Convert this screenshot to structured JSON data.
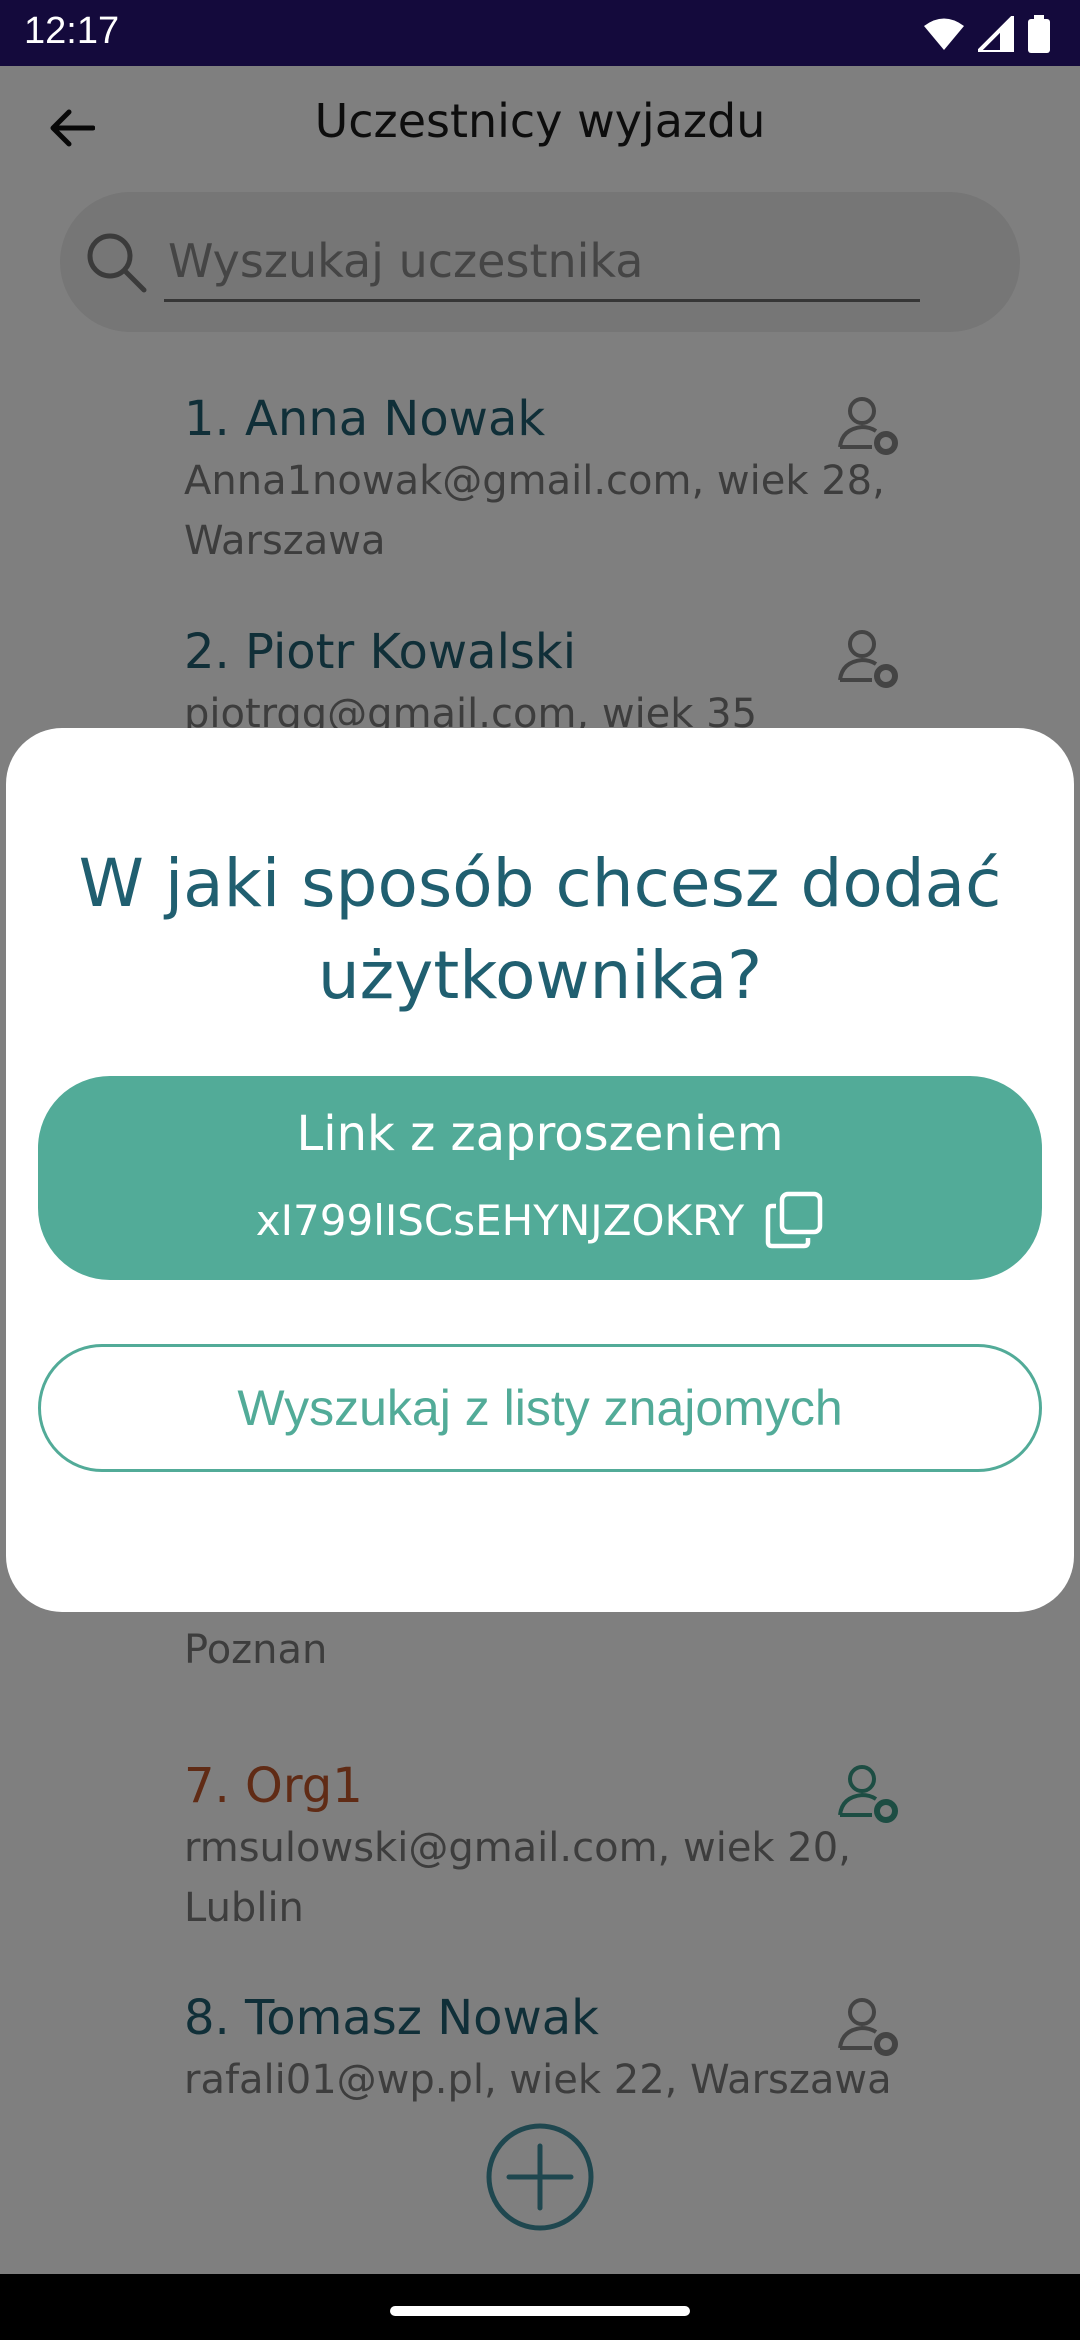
{
  "status_bar": {
    "time": "12:17"
  },
  "screen": {
    "title": "Uczestnicy wyjazdu",
    "search_placeholder": "Wyszukaj uczestnika"
  },
  "participants": [
    {
      "name": "1. Anna Nowak",
      "details": "Anna1nowak@gmail.com, wiek 28, Warszawa"
    },
    {
      "name": "2. Piotr Kowalski",
      "details": "piotrgg@gmail.com, wiek 35"
    },
    {
      "name": "",
      "details": "Poznan"
    },
    {
      "name": "7. Org1",
      "details": "rmsulowski@gmail.com, wiek 20, Lublin"
    },
    {
      "name": "8. Tomasz Nowak",
      "details": "rafali01@wp.pl, wiek 22, Warszawa"
    }
  ],
  "dialog": {
    "title": "W jaki sposób chcesz dodać użytkownika?",
    "invite_label": "Link z zaproszeniem",
    "invite_code": "xI799lISCsEHYNJZOKRY",
    "friends_button": "Wyszukaj z listy znajomych"
  },
  "colors": {
    "primary_text": "#205f70",
    "accent": "#52ab98",
    "organizer": "#c0562a",
    "status_bar": "#140a3c"
  },
  "icons": [
    "back-arrow-icon",
    "search-icon",
    "user-settings-icon",
    "copy-icon",
    "add-circle-icon",
    "wifi-icon",
    "signal-icon",
    "battery-icon"
  ]
}
